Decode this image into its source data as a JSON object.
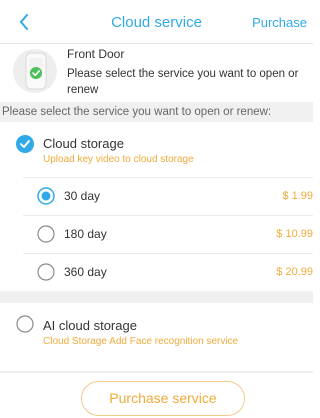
{
  "header": {
    "title": "Cloud service",
    "action_label": "Purchase"
  },
  "device": {
    "name": "Front Door",
    "message": "Please select the service you want to open or renew"
  },
  "prompt": "Please select the service you want to open or renew:",
  "cloud_storage": {
    "title": "Cloud storage",
    "subtitle": "Upload key video to cloud storage",
    "checked": true,
    "options": [
      {
        "label": "30 day",
        "price": "$ 1.99",
        "selected": true
      },
      {
        "label": "180 day",
        "price": "$ 10.99",
        "selected": false
      },
      {
        "label": "360 day",
        "price": "$ 20.99",
        "selected": false
      }
    ]
  },
  "ai_cloud_storage": {
    "title": "AI cloud storage",
    "subtitle": "Cloud Storage Add Face recognition service",
    "selected": false
  },
  "purchase_button_label": "Purchase service",
  "colors": {
    "accent_blue": "#2fa9e8",
    "accent_orange": "#f0ab3a",
    "divider": "#f0f0f0"
  },
  "icons": {
    "back": "chevron-left-icon",
    "device": "camera-device-icon",
    "check": "checkbox-checked-icon"
  }
}
